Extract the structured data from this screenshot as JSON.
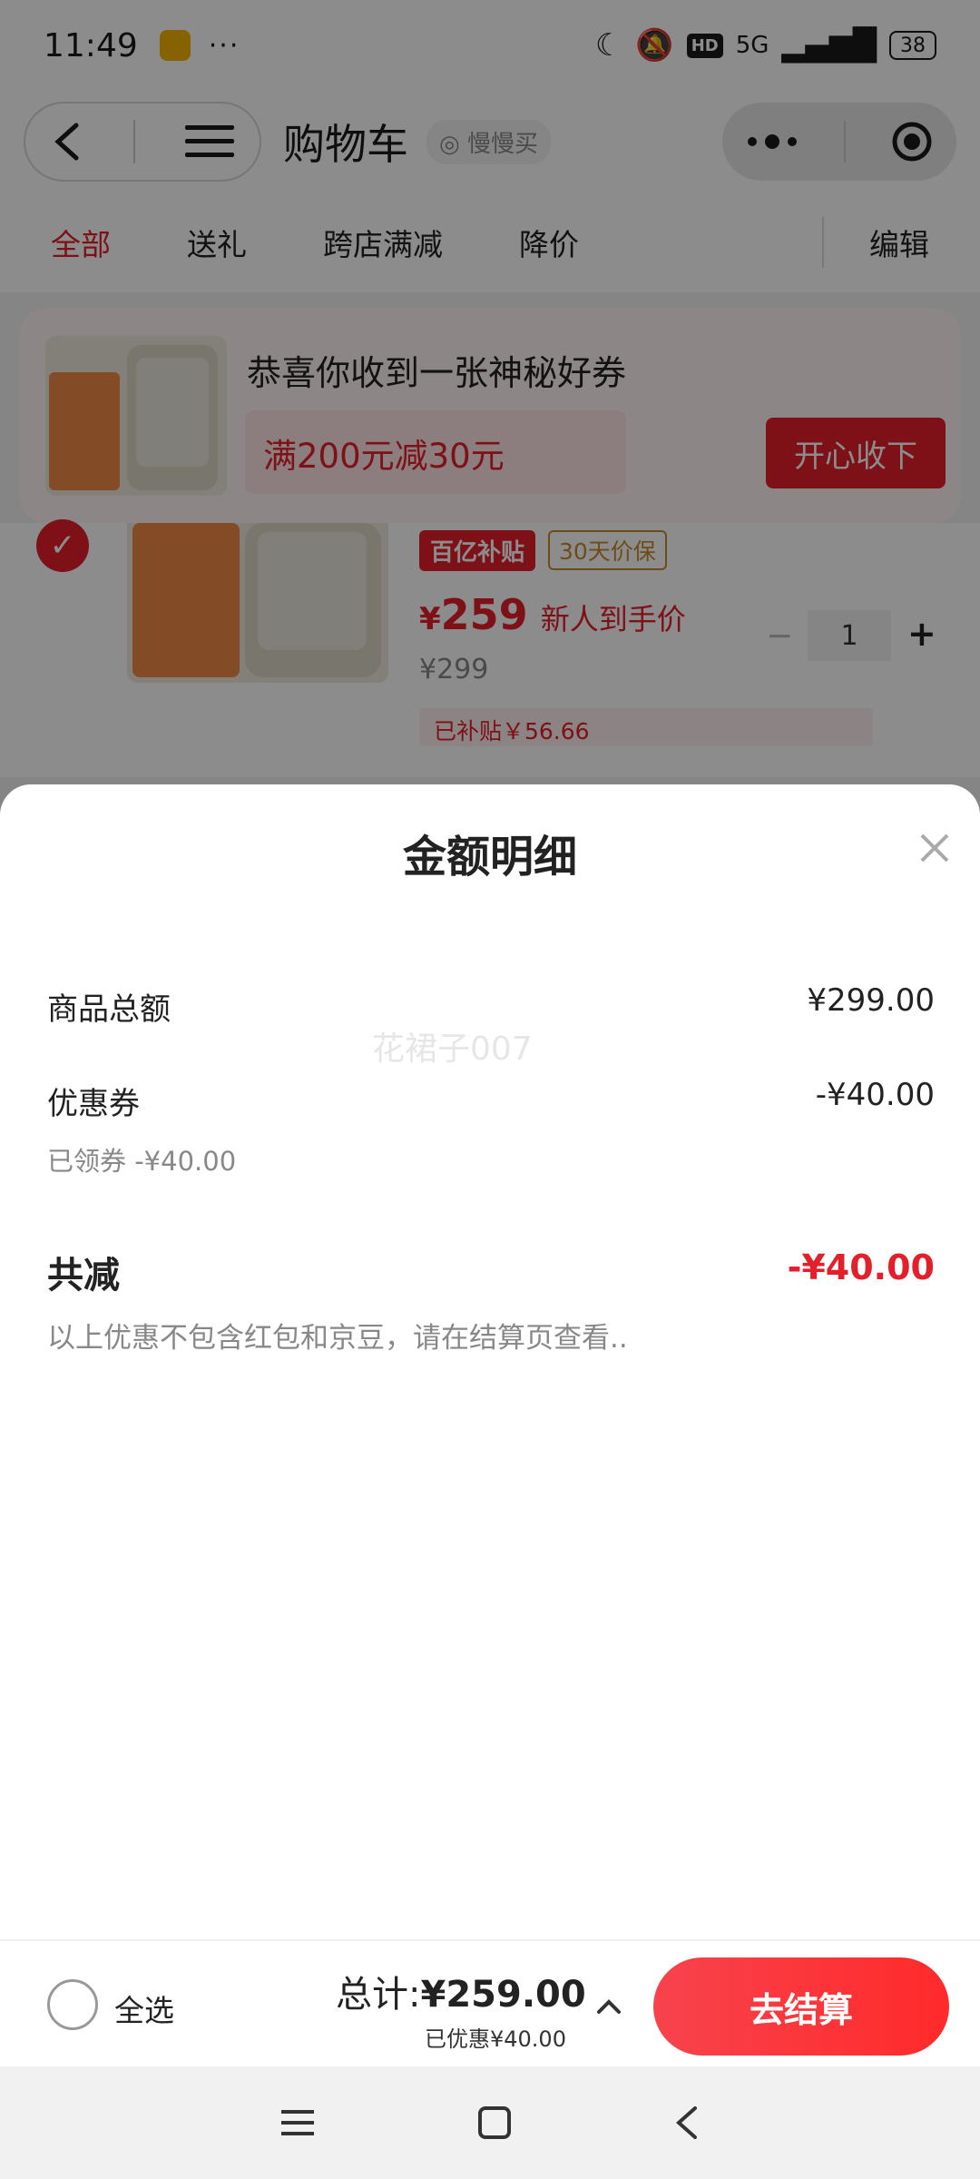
{
  "status_bar": {
    "time": "11:49",
    "dots": "···",
    "network": "5G",
    "hd": "HD",
    "battery": "38"
  },
  "nav": {
    "title": "购物车",
    "tag": "慢慢买"
  },
  "tabs": {
    "items": [
      "全部",
      "送礼",
      "跨店满减",
      "降价"
    ],
    "edit": "编辑"
  },
  "coupon": {
    "title": "恭喜你收到一张神秘好券",
    "offer": "满200元减30元",
    "accept": "开心收下"
  },
  "product": {
    "subsidy_badge": "百亿补贴",
    "price_protect": "30天价保",
    "currency": "¥",
    "price": "259",
    "price_note": "新人到手价",
    "original_price": "¥299",
    "subsidized": "已补贴￥56.66",
    "quantity": "1"
  },
  "sheet": {
    "title": "金额明细",
    "watermark": "花裙子007",
    "goods_total_label": "商品总额",
    "goods_total_value": "¥299.00",
    "coupon_label": "优惠券",
    "coupon_value": "-¥40.00",
    "coupon_sub": "已领券 -¥40.00",
    "reduce_label": "共减",
    "reduce_value": "-¥40.00",
    "note": "以上优惠不包含红包和京豆，请在结算页查看.."
  },
  "bottom_bar": {
    "select_all": "全选",
    "total_prefix": "总计:",
    "total_amount": "¥259.00",
    "saved": "已优惠¥40.00",
    "checkout": "去结算"
  },
  "colors": {
    "accent": "#e3202a"
  }
}
